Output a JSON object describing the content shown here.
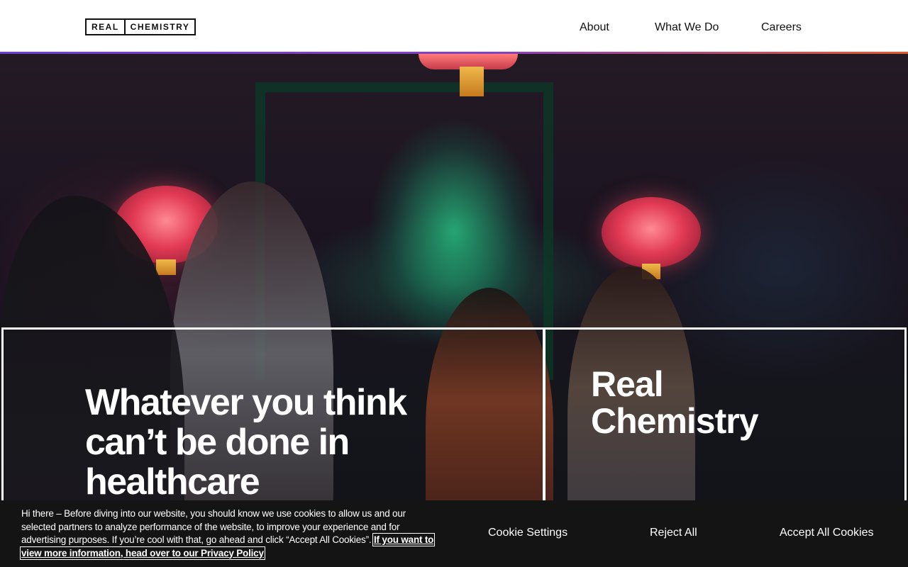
{
  "header": {
    "logo": {
      "left": "REAL",
      "right": "CHEMISTRY"
    },
    "nav": [
      {
        "label": "About"
      },
      {
        "label": "What We Do"
      },
      {
        "label": "Careers"
      }
    ]
  },
  "hero": {
    "headline": "Whatever you think can’t be done in healthcare",
    "brand_title": "Real Chemistry"
  },
  "cookie_banner": {
    "text": "Hi there – Before diving into our website, you should know we use cookies to allow us and our selected partners to analyze performance of the website, to improve your experience and for advertising purposes. If you’re cool with that, go ahead and click “Accept All Cookies”.",
    "link": "If you want to view more information, head over to our Privacy Policy",
    "settings_label": "Cookie Settings",
    "reject_label": "Reject All",
    "accept_label": "Accept All Cookies"
  },
  "colors": {
    "accent_gradient_start": "#6b3fd6",
    "accent_gradient_end": "#e25a2c",
    "banner_bg": "#141414"
  }
}
